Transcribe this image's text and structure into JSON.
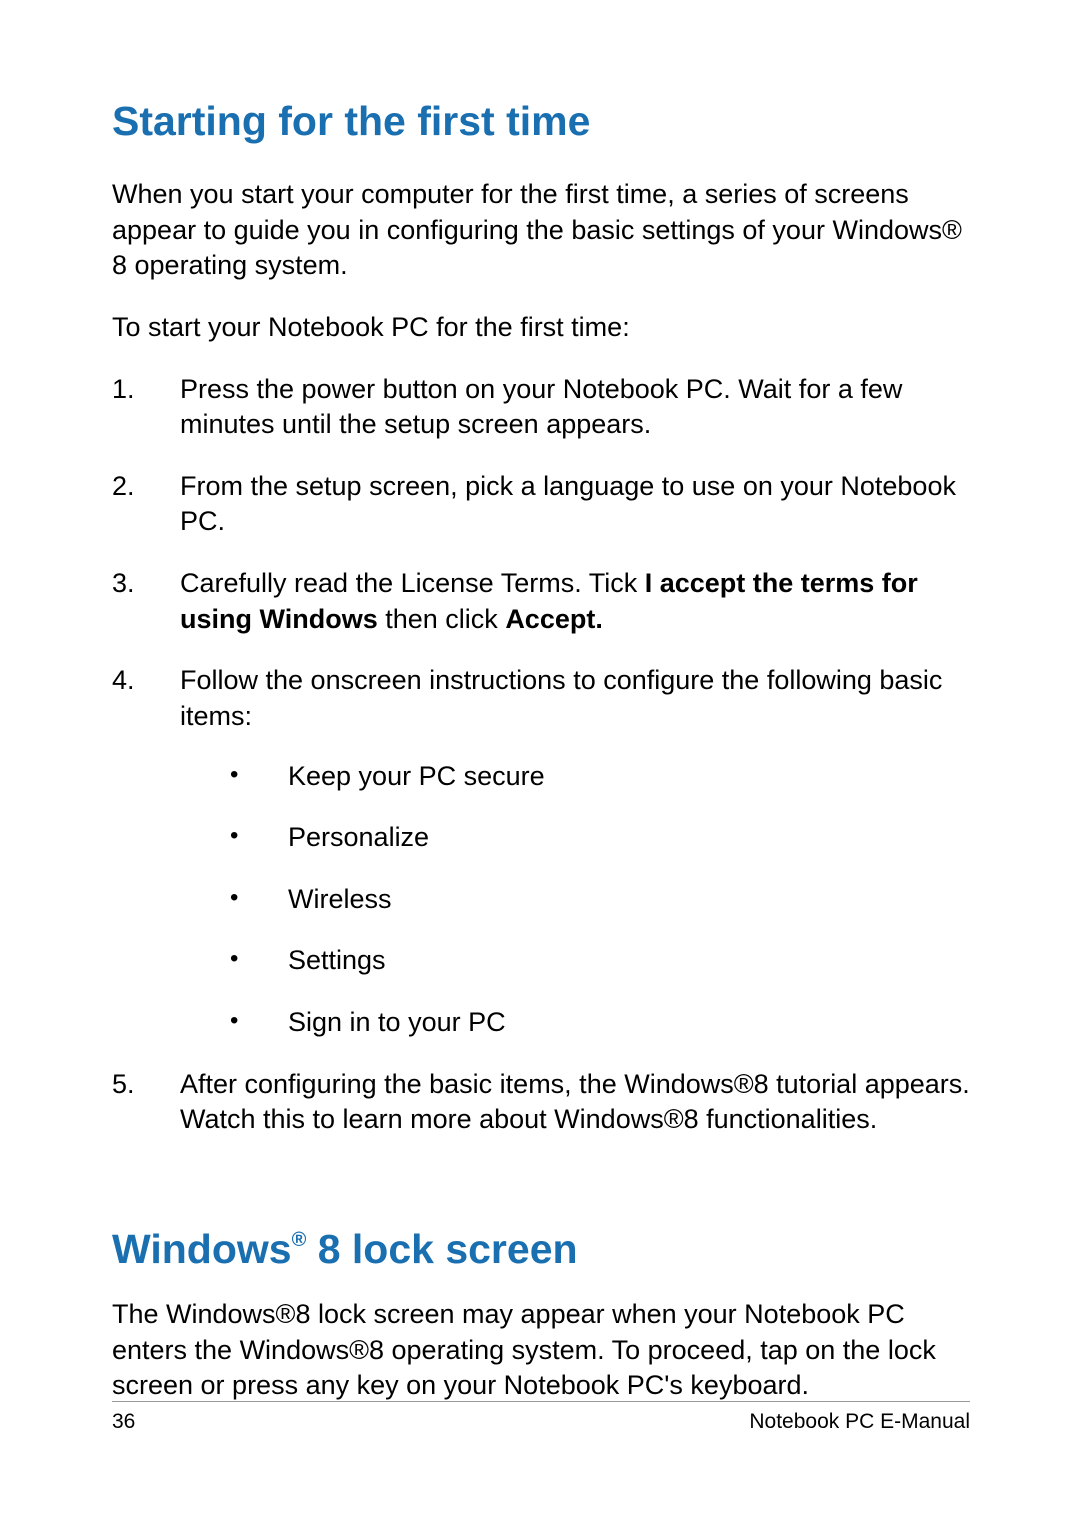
{
  "heading1": "Starting for the first time",
  "para1": "When you start your computer for the first time, a series of screens appear to guide you in configuring the basic settings of your Windows® 8 operating system.",
  "para2": "To start your Notebook PC for the first time:",
  "steps": {
    "s1": "Press the power button on your Notebook PC. Wait for a few minutes until the setup screen appears.",
    "s2": "From the setup screen, pick a language to use on your Notebook PC.",
    "s3_a": "Carefully read the License Terms. Tick ",
    "s3_b": "I accept the terms for using Windows",
    "s3_c": " then click ",
    "s3_d": "Accept.",
    "s4": "Follow the onscreen instructions to configure the following basic items:",
    "bullets": {
      "b1": "Keep your PC secure",
      "b2": "Personalize",
      "b3": "Wireless",
      "b4": "Settings",
      "b5": "Sign in to your PC"
    },
    "s5": "After configuring the basic items, the Windows®8 tutorial appears. Watch this to learn more about Windows®8 functionalities."
  },
  "heading2_a": "Windows",
  "heading2_sup": "®",
  "heading2_b": " 8 lock screen",
  "para3": "The Windows®8 lock screen may appear when your Notebook PC enters the Windows®8 operating system. To proceed,  tap on the lock screen or press any key on your Notebook PC's keyboard.",
  "footer": {
    "page": "36",
    "title": "Notebook PC E-Manual"
  }
}
